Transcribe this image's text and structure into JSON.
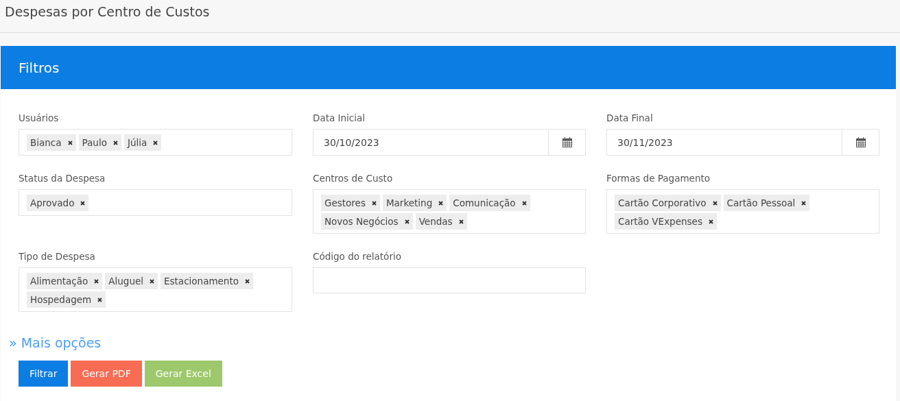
{
  "page_title": "Despesas por Centro de Custos",
  "panel": {
    "title": "Filtros",
    "fields": [
      {
        "kind": "tags",
        "label": "Usuários",
        "tags": [
          "Bianca",
          "Paulo",
          "Júlia"
        ]
      },
      {
        "kind": "date",
        "label": "Data Inicial",
        "value": "30/10/2023"
      },
      {
        "kind": "date",
        "label": "Data Final",
        "value": "30/11/2023"
      },
      {
        "kind": "tags",
        "label": "Status da Despesa",
        "tags": [
          "Aprovado"
        ]
      },
      {
        "kind": "tags",
        "label": "Centros de Custo",
        "tags": [
          "Gestores",
          "Marketing",
          "Comunicação",
          "Novos Negócios",
          "Vendas"
        ]
      },
      {
        "kind": "tags",
        "label": "Formas de Pagamento",
        "tags": [
          "Cartão Corporativo",
          "Cartão Pessoal",
          "Cartão VExpenses"
        ]
      },
      {
        "kind": "tags",
        "label": "Tipo de Despesa",
        "tags": [
          "Alimentação",
          "Aluguel",
          "Estacionamento",
          "Hospedagem"
        ]
      },
      {
        "kind": "text",
        "label": "Código do relatório"
      }
    ],
    "more_link": "» Mais opções",
    "buttons": [
      {
        "kind": "primary",
        "label": "Filtrar"
      },
      {
        "kind": "danger",
        "label": "Gerar PDF"
      },
      {
        "kind": "success",
        "label": "Gerar Excel"
      }
    ]
  }
}
